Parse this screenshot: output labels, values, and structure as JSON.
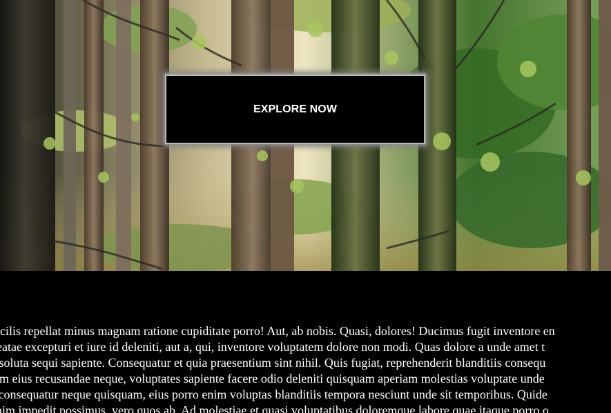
{
  "hero": {
    "cta_label": "EXPLORE NOW"
  },
  "body": {
    "lines": [
      "facilis repellat minus magnam ratione cupiditate porro! Aut, ab nobis. Quasi, dolores! Ducimus fugit inventore en",
      "beatae excepturi et iure id deleniti, aut a, qui, inventore voluptatem dolore non modi. Quas dolore a unde amet t",
      "a soluta sequi sapiente. Consequatur et quia praesentium sint nihil. Quis fugiat, reprehenderit blanditiis consequ",
      "tem eius recusandae neque, voluptates sapiente facere odio deleniti quisquam aperiam molestias voluptate unde",
      "s consequatur neque quisquam, eius porro enim voluptas blanditiis tempora nesciunt unde sit temporibus. Quide",
      "enim impedit possimus, vero quos ab. Ad molestiae et quasi voluptatibus doloremque labore quae itaque porro o"
    ]
  },
  "colors": {
    "background": "#000000",
    "cta_background": "#000000",
    "cta_text": "#ffffff",
    "cta_border": "#b9b9b9",
    "body_text": "#ffffff"
  }
}
